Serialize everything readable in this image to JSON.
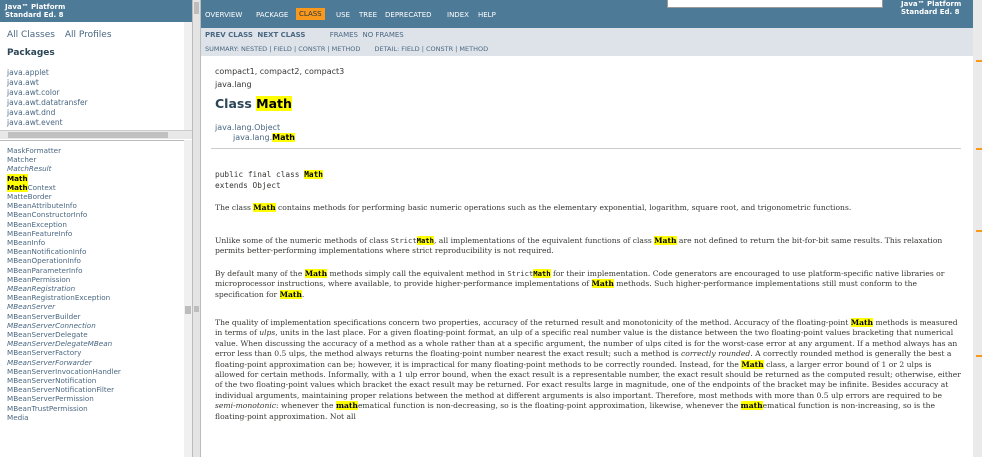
{
  "header": {
    "title_line1": "Java™ Platform",
    "title_line2": "Standard Ed. 8"
  },
  "packages_pane": {
    "all_classes": "All Classes",
    "all_profiles": "All Profiles",
    "title": "Packages",
    "items": [
      "java.applet",
      "java.awt",
      "java.awt.color",
      "java.awt.datatransfer",
      "java.awt.dnd",
      "java.awt.event"
    ]
  },
  "classes_pane": {
    "items": [
      {
        "label": "MaskFormatter",
        "italic": false
      },
      {
        "label": "Matcher",
        "italic": false
      },
      {
        "label": "MatchResult",
        "italic": true
      },
      {
        "label": "Math",
        "italic": false,
        "hl": "Math"
      },
      {
        "label": "MathContext",
        "italic": false,
        "hl": "Math"
      },
      {
        "label": "MatteBorder",
        "italic": false
      },
      {
        "label": "MBeanAttributeInfo",
        "italic": false
      },
      {
        "label": "MBeanConstructorInfo",
        "italic": false
      },
      {
        "label": "MBeanException",
        "italic": false
      },
      {
        "label": "MBeanFeatureInfo",
        "italic": false
      },
      {
        "label": "MBeanInfo",
        "italic": false
      },
      {
        "label": "MBeanNotificationInfo",
        "italic": false
      },
      {
        "label": "MBeanOperationInfo",
        "italic": false
      },
      {
        "label": "MBeanParameterInfo",
        "italic": false
      },
      {
        "label": "MBeanPermission",
        "italic": false
      },
      {
        "label": "MBeanRegistration",
        "italic": true
      },
      {
        "label": "MBeanRegistrationException",
        "italic": false
      },
      {
        "label": "MBeanServer",
        "italic": true
      },
      {
        "label": "MBeanServerBuilder",
        "italic": false
      },
      {
        "label": "MBeanServerConnection",
        "italic": true
      },
      {
        "label": "MBeanServerDelegate",
        "italic": false
      },
      {
        "label": "MBeanServerDelegateMBean",
        "italic": true
      },
      {
        "label": "MBeanServerFactory",
        "italic": false
      },
      {
        "label": "MBeanServerForwarder",
        "italic": true
      },
      {
        "label": "MBeanServerInvocationHandler",
        "italic": false
      },
      {
        "label": "MBeanServerNotification",
        "italic": false
      },
      {
        "label": "MBeanServerNotificationFilter",
        "italic": false
      },
      {
        "label": "MBeanServerPermission",
        "italic": false
      },
      {
        "label": "MBeanTrustPermission",
        "italic": false
      },
      {
        "label": "Media",
        "italic": false
      }
    ]
  },
  "topnav": {
    "items": [
      "OVERVIEW",
      "PACKAGE",
      "CLASS",
      "USE",
      "TREE",
      "DEPRECATED",
      "INDEX",
      "HELP"
    ],
    "active": "CLASS",
    "right_title_line1": "Java™ Platform",
    "right_title_line2": "Standard Ed. 8"
  },
  "subnav": {
    "prev_class": "PREV CLASS",
    "next_class": "NEXT CLASS",
    "frames": "FRAMES",
    "no_frames": "NO FRAMES",
    "summary": "SUMMARY: NESTED | FIELD | CONSTR | METHOD",
    "detail": "DETAIL: FIELD | CONSTR | METHOD"
  },
  "doc": {
    "compact": "compact1, compact2, compact3",
    "package": "java.lang",
    "title_prefix": "Class ",
    "title_name": "Math",
    "inherit_parent": "java.lang.Object",
    "inherit_child_prefix": "java.lang.",
    "inherit_child": "Math",
    "sig_line1_prefix": "public final class ",
    "sig_line1_name": "Math",
    "sig_line2": "extends Object",
    "hl_word": "Math",
    "hl_lower": "math"
  }
}
